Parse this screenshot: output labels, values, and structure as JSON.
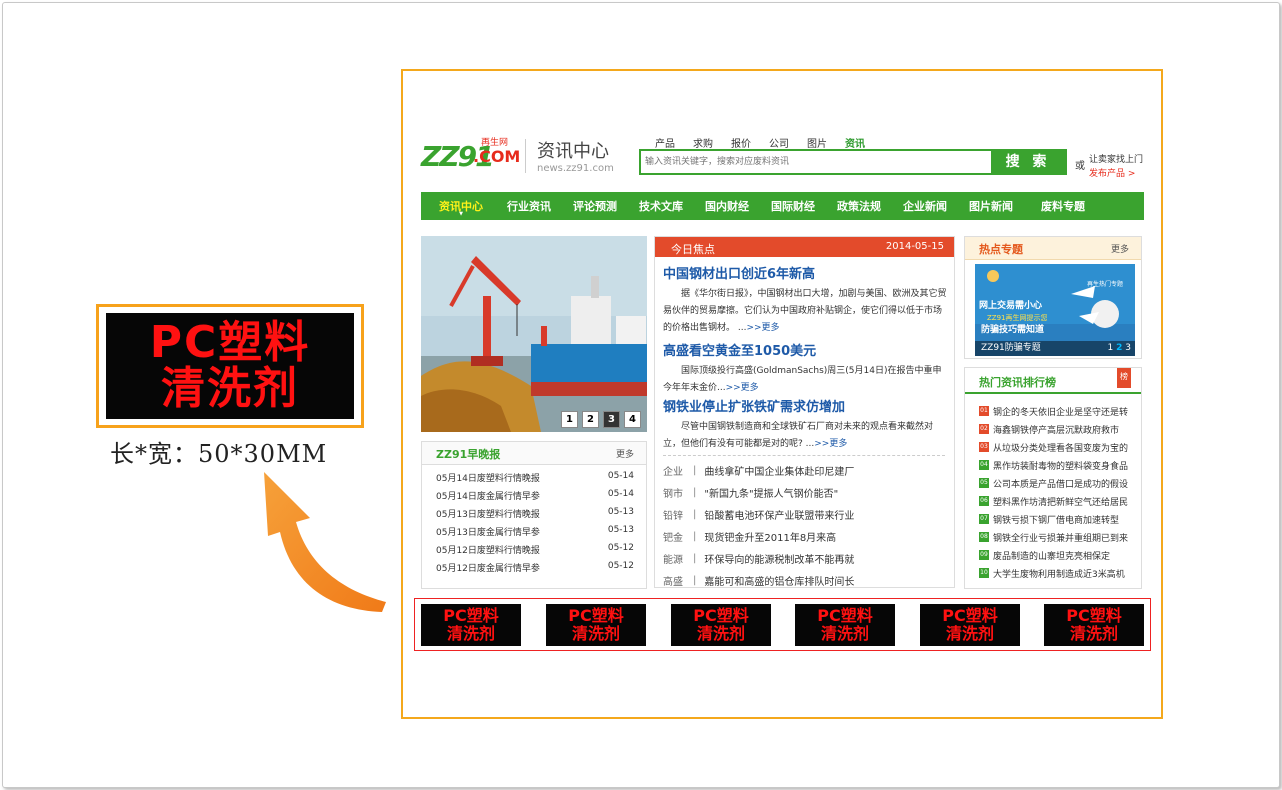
{
  "left_sample": {
    "line1": "PC塑料",
    "line2": "清洗剂",
    "size_note": "长*宽：50*30MM"
  },
  "site": {
    "logo": {
      "main": "ZZ91",
      "com": ".COM",
      "tag": "再生网"
    },
    "title": "资讯中心",
    "domain": "news.zz91.com",
    "search_tabs": [
      "产品",
      "求购",
      "报价",
      "公司",
      "图片",
      "资讯"
    ],
    "search_active": "资讯",
    "search_placeholder": "输入资讯关键字，搜索对应废料资讯",
    "search_button": "搜 索",
    "or_text": "或",
    "publish_line1": "让卖家找上门",
    "publish_line2": "发布产品 >",
    "nav": [
      "资讯中心",
      "行业资讯",
      "评论预测",
      "技术文库",
      "国内财经",
      "国际财经",
      "政策法规",
      "企业新闻",
      "图片新闻",
      "废料专题"
    ],
    "slide_numbers": [
      "1",
      "2",
      "3",
      "4"
    ],
    "slide_active": "3",
    "morning": {
      "title": "ZZ91早晚报",
      "more": "更多",
      "items": [
        {
          "text": "05月14日废塑料行情晚报",
          "date": "05-14"
        },
        {
          "text": "05月14日废金属行情早参",
          "date": "05-14"
        },
        {
          "text": "05月13日废塑料行情晚报",
          "date": "05-13"
        },
        {
          "text": "05月13日废金属行情早参",
          "date": "05-13"
        },
        {
          "text": "05月12日废塑料行情晚报",
          "date": "05-12"
        },
        {
          "text": "05月12日废金属行情早参",
          "date": "05-12"
        }
      ]
    },
    "focus": {
      "title": "今日焦点",
      "date": "2014-05-15",
      "stories": [
        {
          "headline": "中国钢材出口创近6年新高",
          "body": "据《华尔街日报》，中国钢材出口大增，加剧与美国、欧洲及其它贸易伙伴的贸易摩擦。它们认为中国政府补贴钢企，使它们得以低于市场的价格出售钢材。 ...",
          "more": ">>更多"
        },
        {
          "headline": "高盛看空黄金至1050美元",
          "body": "国际顶级投行高盛(GoldmanSachs)周三(5月14日)在报告中重申今年年末金价...",
          "more": ">>更多"
        },
        {
          "headline": "钢铁业停止扩张铁矿需求仿增加",
          "body": "尽管中国钢铁制造商和全球铁矿石厂商对未来的观点看来截然对立，但他们有没有可能都是对的呢? ...",
          "more": ">>更多"
        }
      ],
      "categories": [
        {
          "cat": "企业",
          "text": "曲线拿矿中国企业集体赴印尼建厂"
        },
        {
          "cat": "钢市",
          "text": "\"新国九条\"提振人气钢价能否\""
        },
        {
          "cat": "铅锌",
          "text": "铅酸蓄电池环保产业联盟带来行业"
        },
        {
          "cat": "钯金",
          "text": "现货钯金升至2011年8月来高"
        },
        {
          "cat": "能源",
          "text": "环保导向的能源税制改革不能再就"
        },
        {
          "cat": "高盛",
          "text": "嘉能可和高盛的铝仓库排队时间长"
        }
      ]
    },
    "hot": {
      "title": "热点专题",
      "more": "更多",
      "caption": "ZZ91防骗专题",
      "pages": [
        "1",
        "2",
        "3"
      ],
      "img_text1": "网上交易需小心",
      "img_text2": "ZZ91再生网提示您",
      "img_text3": "防骗技巧需知道",
      "img_text4": "再生热门专题"
    },
    "rank": {
      "title": "热门资讯排行榜",
      "tag": "榜",
      "items": [
        {
          "no": "01",
          "text": "钢企的冬天依旧企业是坚守还是转"
        },
        {
          "no": "02",
          "text": "海鑫钢铁停产高层沉默政府救市"
        },
        {
          "no": "03",
          "text": "从垃圾分类处理看各国变废为宝的"
        },
        {
          "no": "04",
          "text": "黑作坊装耐毒物的塑料袋变身食品"
        },
        {
          "no": "05",
          "text": "公司本质是产品借口是成功的假设"
        },
        {
          "no": "06",
          "text": "塑料黑作坊清把新鲜空气还给居民"
        },
        {
          "no": "07",
          "text": "钢铁亏损下钢厂借电商加速转型"
        },
        {
          "no": "08",
          "text": "钢铁全行业亏损兼并重组期已到来"
        },
        {
          "no": "09",
          "text": "废品制造的山寨坦克亮相保定"
        },
        {
          "no": "10",
          "text": "大学生废物利用制造成近3米高机"
        }
      ]
    },
    "banner_ads": [
      {
        "l1": "PC塑料",
        "l2": "清洗剂"
      },
      {
        "l1": "PC塑料",
        "l2": "清洗剂"
      },
      {
        "l1": "PC塑料",
        "l2": "清洗剂"
      },
      {
        "l1": "PC塑料",
        "l2": "清洗剂"
      },
      {
        "l1": "PC塑料",
        "l2": "清洗剂"
      },
      {
        "l1": "PC塑料",
        "l2": "清洗剂"
      }
    ]
  },
  "colors": {
    "brand_green": "#3aa32f",
    "focus_red": "#e34b2b",
    "frame_orange": "#f4a81c",
    "ad_red": "#ff1111"
  }
}
